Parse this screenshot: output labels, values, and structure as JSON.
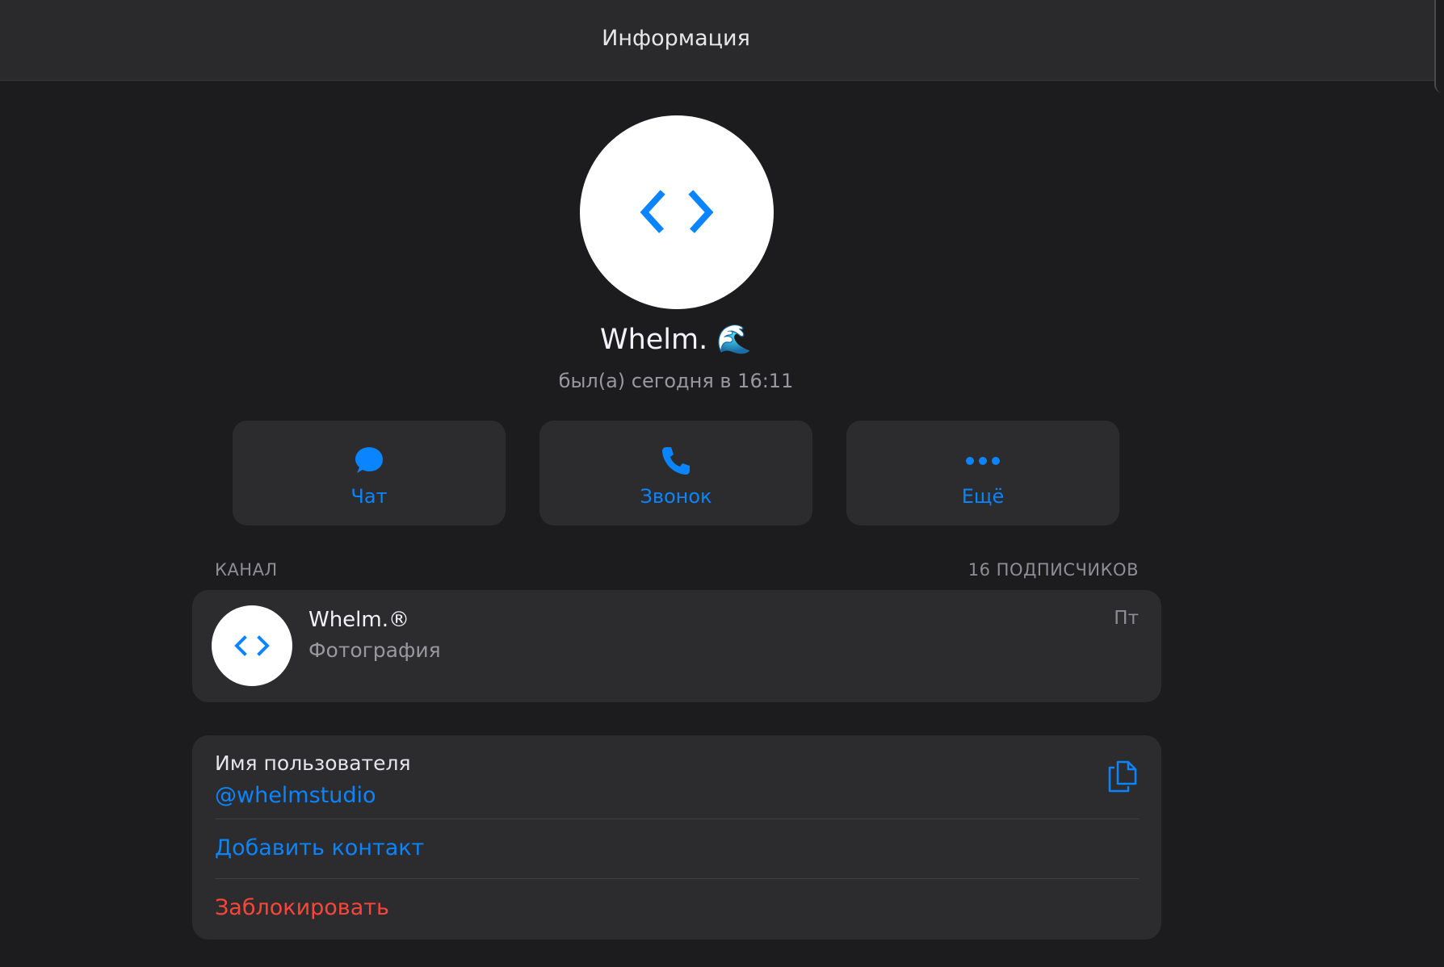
{
  "header": {
    "title": "Информация"
  },
  "profile": {
    "name": "Whelm.",
    "name_emoji": "🌊",
    "status": "был(а) сегодня в 16:11",
    "avatar_icon": "code-brackets-icon"
  },
  "actions": [
    {
      "label": "Чат",
      "icon": "chat-bubble-icon"
    },
    {
      "label": "Звонок",
      "icon": "phone-icon"
    },
    {
      "label": "Ещё",
      "icon": "more-dots-icon"
    }
  ],
  "channel_section": {
    "label": "КАНАЛ",
    "subscribers": "16 ПОДПИСЧИКОВ",
    "channel": {
      "name": "Whelm.®",
      "last_message": "Фотография",
      "time": "Пт"
    }
  },
  "info": {
    "username_label": "Имя пользователя",
    "username": "@whelmstudio",
    "add_contact": "Добавить контакт",
    "block": "Заблокировать"
  },
  "colors": {
    "accent": "#0a84ff",
    "destructive": "#ff453a",
    "background": "#1c1c1e",
    "card": "#2c2c2e"
  }
}
